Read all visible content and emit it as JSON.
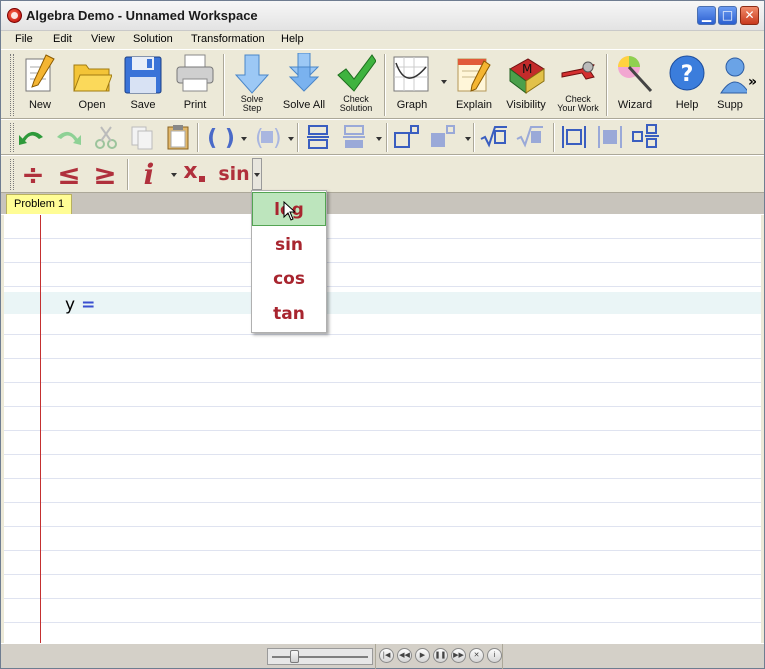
{
  "window": {
    "title": "Algebra Demo - Unnamed Workspace"
  },
  "menu": [
    "File",
    "Edit",
    "View",
    "Solution",
    "Transformation",
    "Help"
  ],
  "toolbar": {
    "new": "New",
    "open": "Open",
    "save": "Save",
    "print": "Print",
    "solve_step_1": "Solve",
    "solve_step_2": "Step",
    "solve_all": "Solve All",
    "check_solution_1": "Check",
    "check_solution_2": "Solution",
    "graph": "Graph",
    "explain": "Explain",
    "visibility": "Visibility",
    "check_work_1": "Check",
    "check_work_2": "Your Work",
    "wizard": "Wizard",
    "help": "Help",
    "support": "Supp",
    "overflow": "»",
    "visibility_letter": "M"
  },
  "math_toolbar": {
    "divide": "÷",
    "le": "≤",
    "ge": "≥",
    "italic": "i",
    "subscript": "x",
    "sin": "sin"
  },
  "tabs": [
    {
      "label": "Problem 1"
    }
  ],
  "equation": {
    "lhs": "y",
    "eq": "="
  },
  "function_menu": [
    "log",
    "sin",
    "cos",
    "tan"
  ],
  "colors": {
    "accent_red": "#a8252f",
    "hover_green": "#bde5bd",
    "margin_red": "#c43030"
  }
}
